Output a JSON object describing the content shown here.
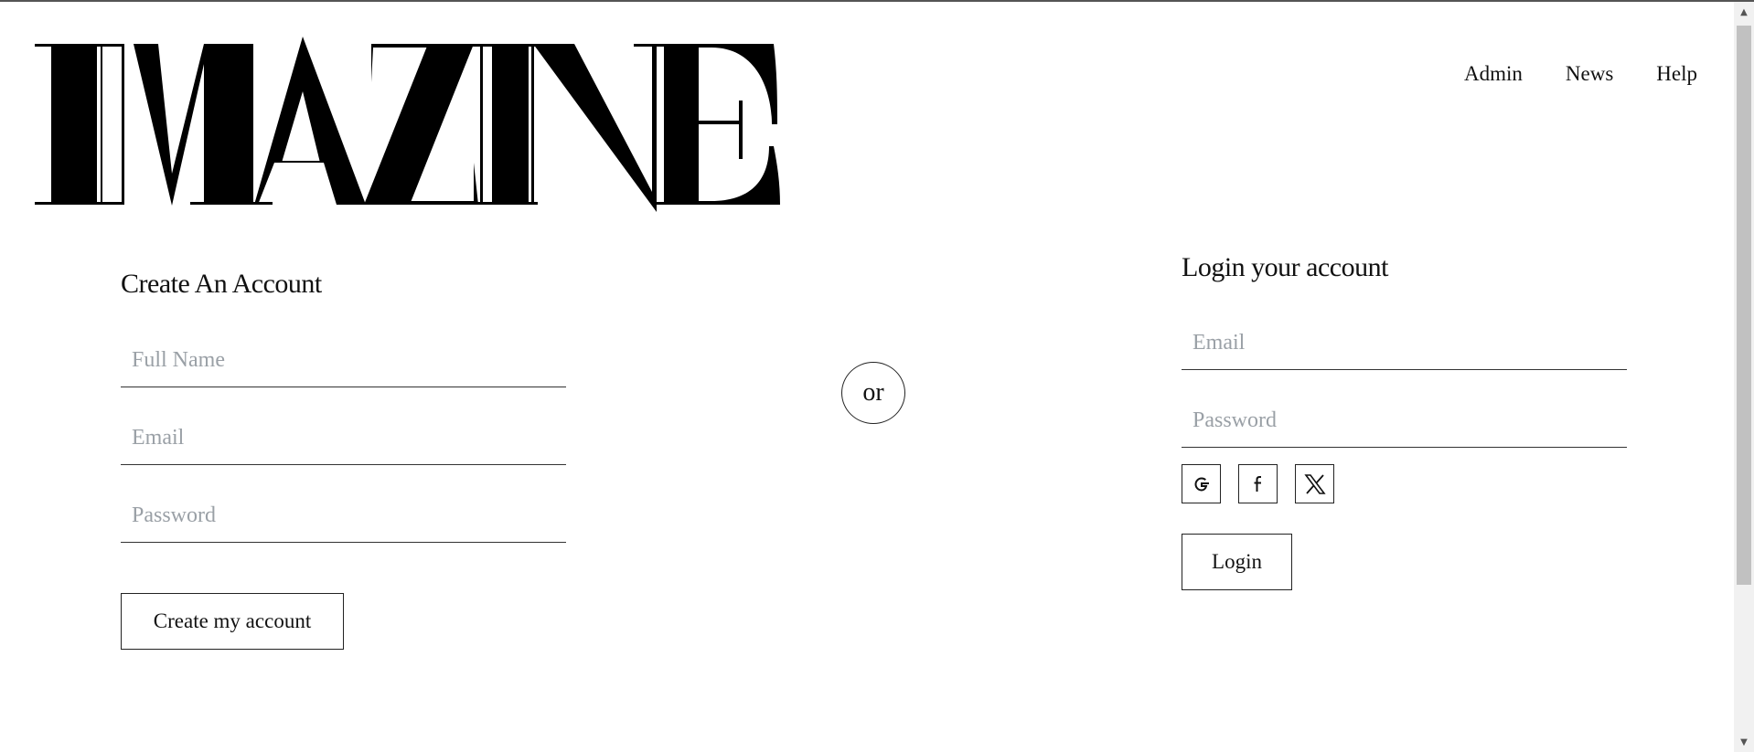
{
  "logo": {
    "text": "IMAZINE"
  },
  "nav": {
    "items": [
      {
        "label": "Admin"
      },
      {
        "label": "News"
      },
      {
        "label": "Help"
      }
    ]
  },
  "register": {
    "title": "Create An Account",
    "full_name_placeholder": "Full Name",
    "email_placeholder": "Email",
    "password_placeholder": "Password",
    "submit_label": "Create my account"
  },
  "divider": {
    "label": "or"
  },
  "login": {
    "title": "Login your account",
    "email_placeholder": "Email",
    "password_placeholder": "Password",
    "social": [
      {
        "icon": "google-icon"
      },
      {
        "icon": "facebook-icon"
      },
      {
        "icon": "x-icon"
      }
    ],
    "submit_label": "Login"
  },
  "colors": {
    "text": "#111111",
    "placeholder": "#9aa0a6",
    "border": "#222222",
    "background": "#ffffff"
  }
}
